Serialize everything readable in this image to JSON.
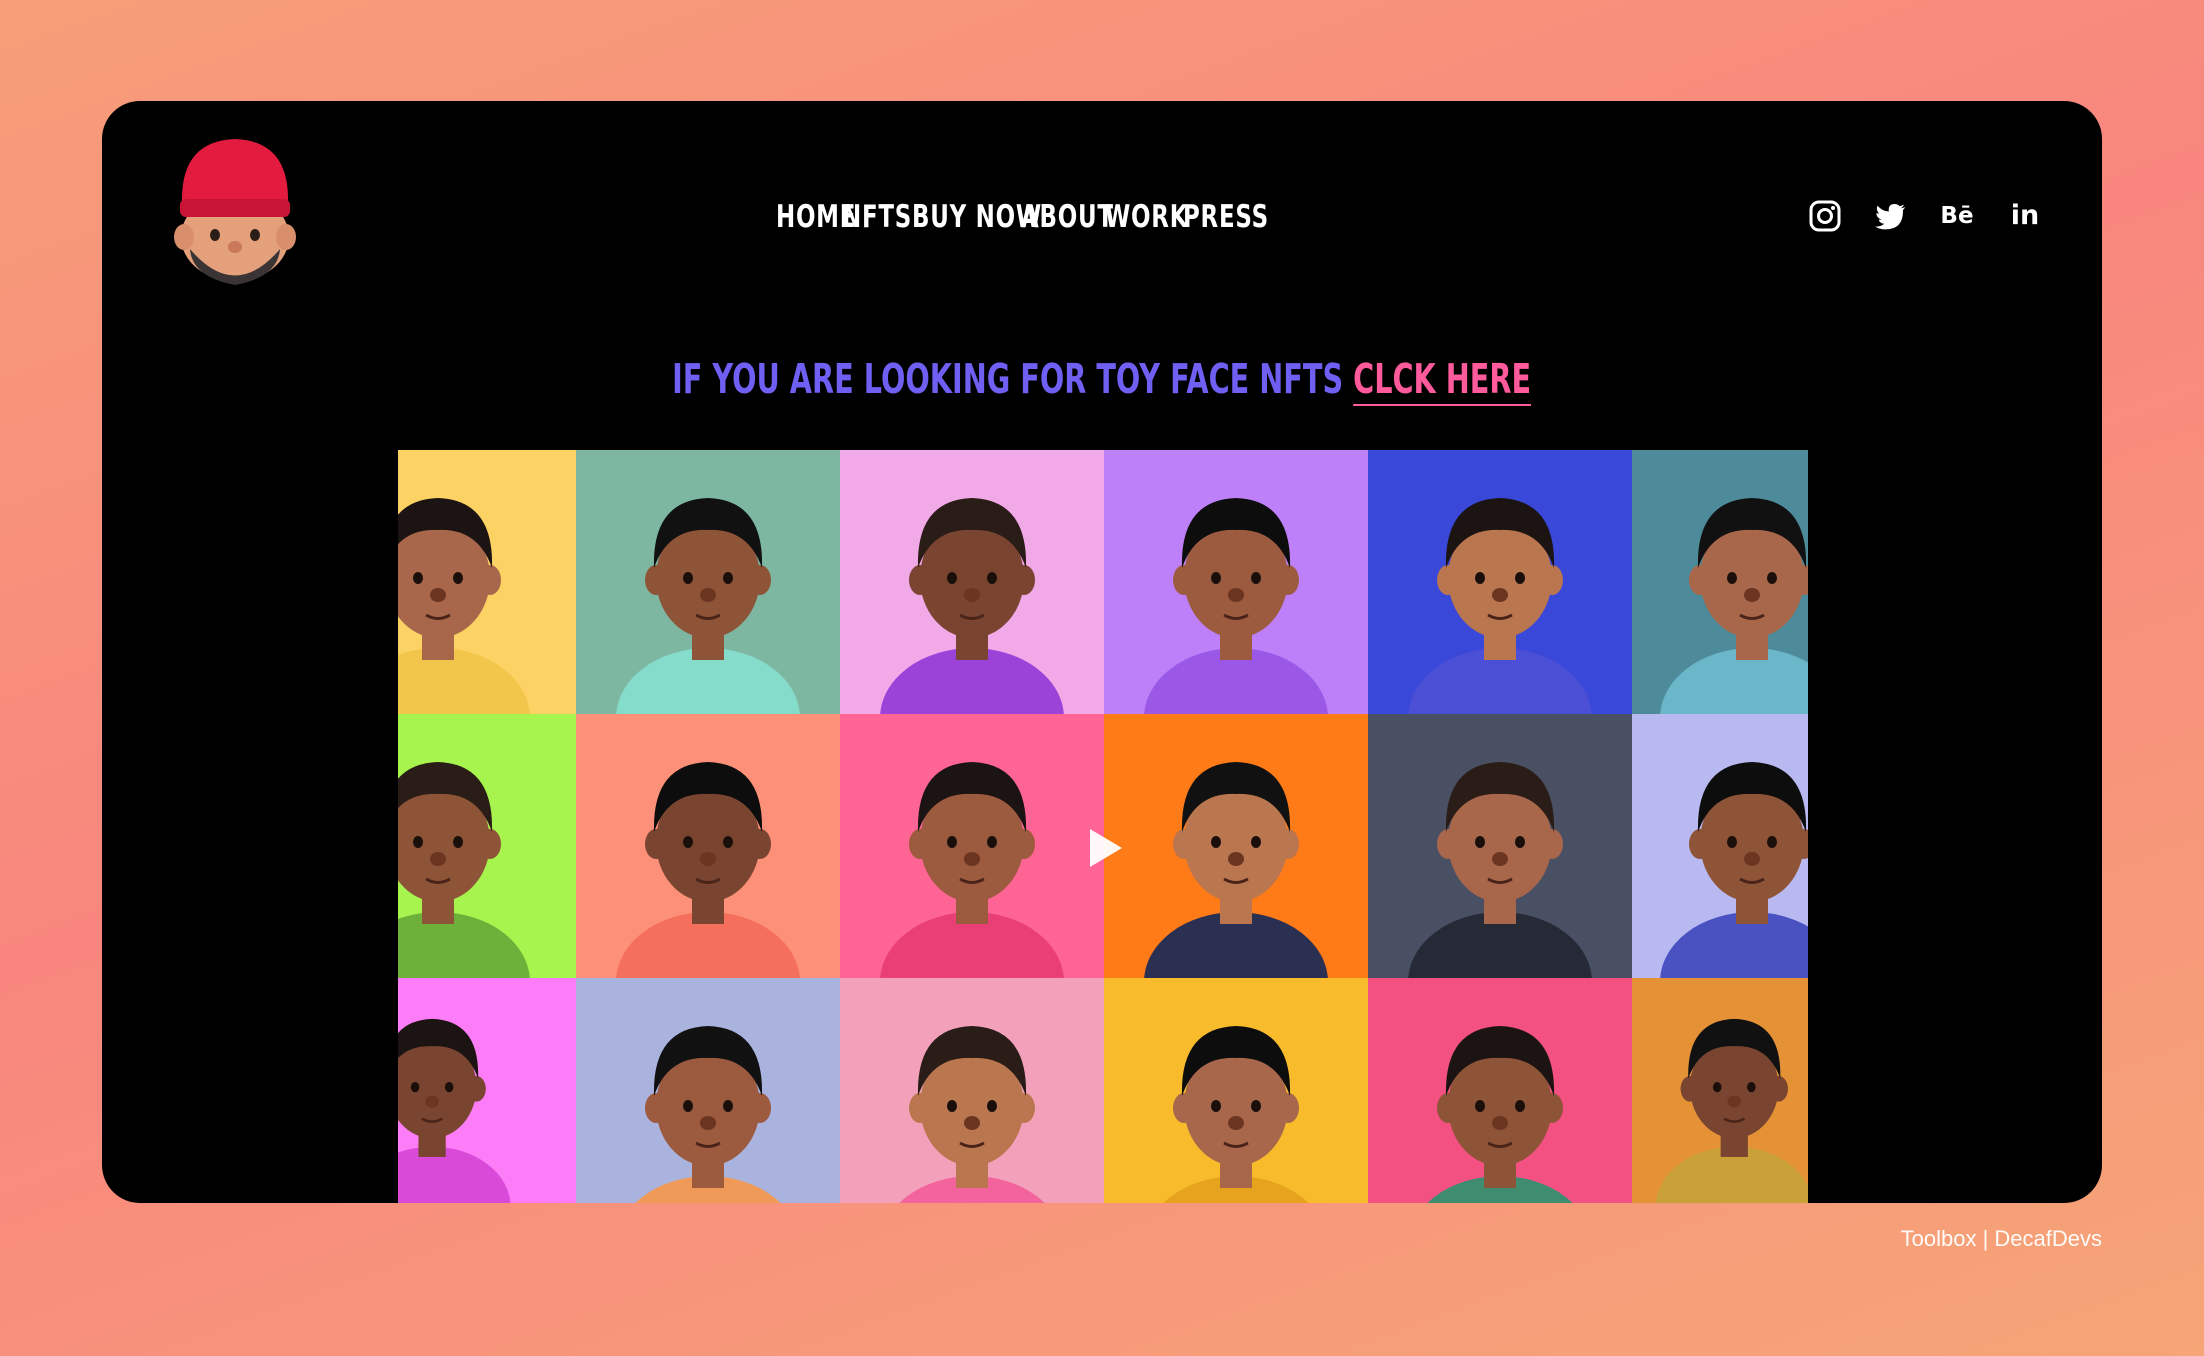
{
  "nav": {
    "items": [
      "HOME",
      "NFTS",
      "BUY NOW",
      "ABOUT",
      "WORK",
      "PRESS"
    ]
  },
  "social": {
    "icons": [
      "instagram-icon",
      "twitter-icon",
      "behance-icon",
      "linkedin-icon"
    ],
    "behance_text": "Bē",
    "linkedin_text": "in"
  },
  "headline": {
    "text": "IF YOU ARE LOOKING FOR TOY FACE NFTS ",
    "link": "CLCK HERE",
    "text_color": "#6f5ff2",
    "link_color": "#ff5a9b"
  },
  "grid": {
    "backgrounds": [
      [
        "#fcd264",
        "#7db7a2",
        "#f1a9e8",
        "#bd80f8",
        "#3a48d9",
        "#4d8a9a"
      ],
      [
        "#a8f44e",
        "#fd9078",
        "#ff6594",
        "#ff7b18",
        "#4a5064",
        "#b8b9f0"
      ],
      [
        "#fd7cf7",
        "#a9b3dd",
        "#f3a0ba",
        "#f8bb2c",
        "#f25181",
        "#e59237"
      ]
    ],
    "play_icon": "play-icon"
  },
  "footer": {
    "credit": "Toolbox | DecafDevs"
  },
  "colors": {
    "frame": "#000000",
    "nav_text": "#ffffff"
  }
}
